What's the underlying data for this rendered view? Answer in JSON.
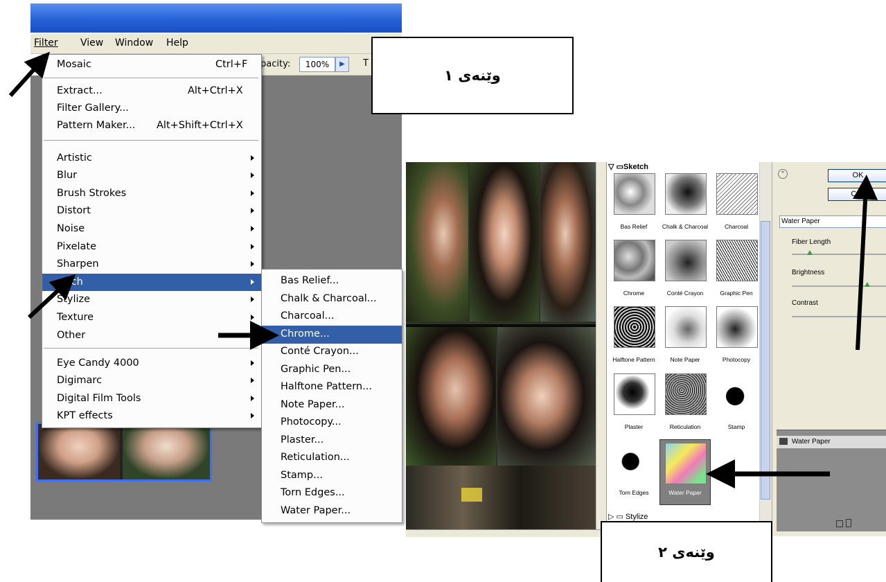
{
  "menubar": {
    "items": [
      "Filter",
      "View",
      "Window",
      "Help"
    ]
  },
  "options_bar": {
    "opacity_label": "pacity:",
    "opacity_value": "100%",
    "trailing": "T"
  },
  "filter_menu": {
    "items": [
      {
        "label": "Mosaic",
        "shortcut": "Ctrl+F"
      },
      {
        "label": "Extract...",
        "shortcut": "Alt+Ctrl+X"
      },
      {
        "label": "Filter Gallery...",
        "shortcut": ""
      },
      {
        "label": "Pattern Maker...",
        "shortcut": "Alt+Shift+Ctrl+X"
      },
      {
        "label": "Artistic"
      },
      {
        "label": "Blur"
      },
      {
        "label": "Brush Strokes"
      },
      {
        "label": "Distort"
      },
      {
        "label": "Noise"
      },
      {
        "label": "Pixelate"
      },
      {
        "label": "Sharpen"
      },
      {
        "label": "tch"
      },
      {
        "label": "Stylize"
      },
      {
        "label": "Texture"
      },
      {
        "label": "Other"
      },
      {
        "label": "Eye Candy 4000"
      },
      {
        "label": "Digimarc"
      },
      {
        "label": "Digital Film Tools"
      },
      {
        "label": "KPT effects"
      }
    ]
  },
  "sketch_submenu": {
    "items": [
      "Bas Relief...",
      "Chalk & Charcoal...",
      "Charcoal...",
      "Chrome...",
      "Conté Crayon...",
      "Graphic Pen...",
      "Halftone Pattern...",
      "Note Paper...",
      "Photocopy...",
      "Plaster...",
      "Reticulation...",
      "Stamp...",
      "Torn Edges...",
      "Water Paper..."
    ]
  },
  "callouts": {
    "figure1": "وێنەی ١",
    "figure2": "وێنەی ٢"
  },
  "gallery": {
    "category_open": "Sketch",
    "category_next": "Stylize",
    "thumbs": [
      "Bas Relief",
      "Chalk & Charcoal",
      "Charcoal",
      "Chrome",
      "Conté Crayon",
      "Graphic Pen",
      "Halftone Pattern",
      "Note Paper",
      "Photocopy",
      "Plaster",
      "Reticulation",
      "Stamp",
      "Torn Edges",
      "Water Paper"
    ],
    "ok": "OK",
    "cancel": "Can",
    "filter_select": "Water Paper",
    "params": [
      "Fiber Length",
      "Brightness",
      "Contrast"
    ],
    "layer": "Water Paper"
  },
  "colors": {
    "menu_highlight": "#335ea8",
    "titlebar": "#2462d8",
    "frame_blue": "#3e6ff2"
  }
}
